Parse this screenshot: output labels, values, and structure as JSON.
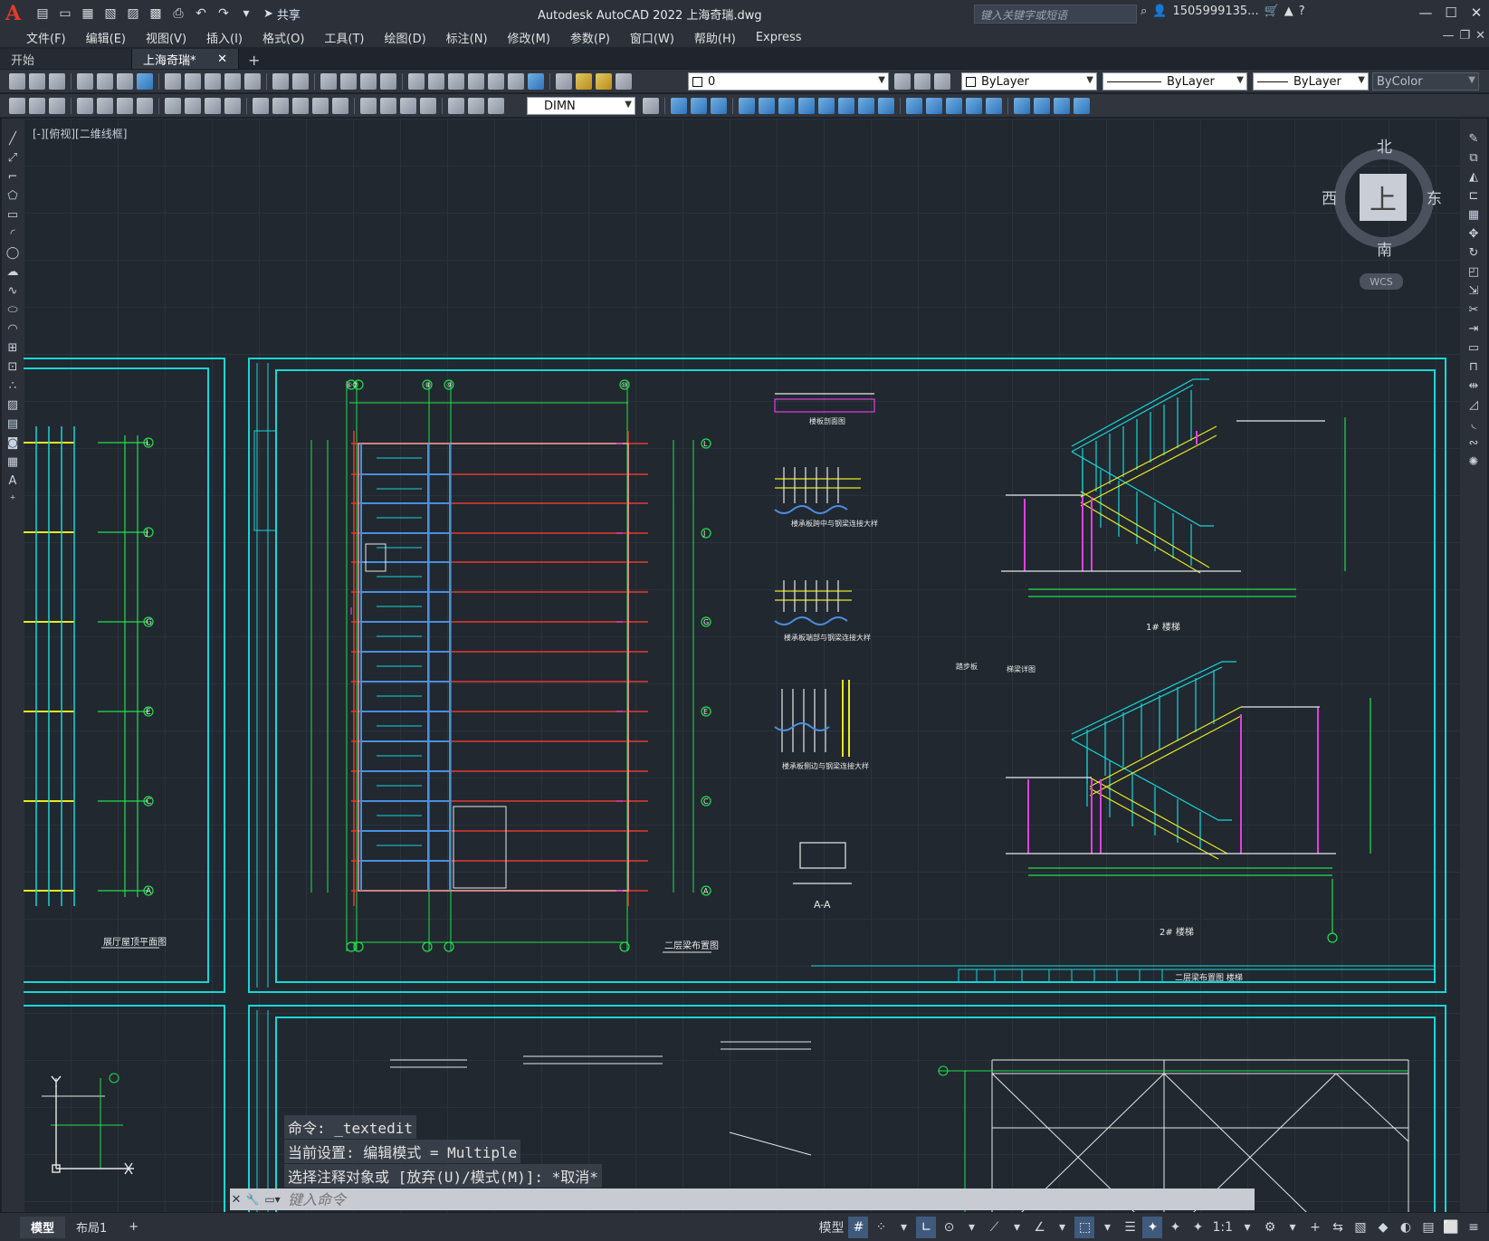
{
  "app": {
    "logo": "A",
    "title": "Autodesk AutoCAD 2022    上海奇瑞.dwg",
    "share_label": "共享",
    "search_placeholder": "键入关键字或短语",
    "user": "1505999135...",
    "accent": "#e23a2e"
  },
  "menu": [
    "文件(F)",
    "编辑(E)",
    "视图(V)",
    "插入(I)",
    "格式(O)",
    "工具(T)",
    "绘图(D)",
    "标注(N)",
    "修改(M)",
    "参数(P)",
    "窗口(W)",
    "帮助(H)",
    "Express"
  ],
  "tabs": {
    "start": "开始",
    "active": "上海奇瑞*",
    "close": "✕",
    "add": "+"
  },
  "toolbar": {
    "layer_value": "0",
    "color_value": "ByLayer",
    "linetype_value": "ByLayer",
    "lineweight_value": "ByLayer",
    "plotstyle_value": "ByColor",
    "dimstyle_value": "DIMN"
  },
  "viewport": {
    "label": "[-][俯视][二维线框]"
  },
  "viewcube": {
    "top": "上",
    "north": "北",
    "south": "南",
    "east": "东",
    "west": "西",
    "wcs": "WCS"
  },
  "drawing": {
    "grid_top_labels": [
      "⑥⑦",
      "⑧",
      "⑨",
      "⑩"
    ],
    "row_labels_right": [
      "L",
      "J",
      "G",
      "E",
      "C",
      "A"
    ],
    "row_labels_left": [
      "L",
      "J",
      "G",
      "E",
      "C",
      "A"
    ],
    "caption_plan": "二层梁布置图",
    "caption_left": "展厅屋顶平面图",
    "caption_stair1": "1# 楼梯",
    "caption_stair2": "2# 楼梯",
    "caption_section": "A-A",
    "caption_detail1": "楼板剖面图",
    "caption_detail2": "楼承板跨中与钢梁连接大样",
    "caption_detail3": "楼承板端部与钢梁连接大样",
    "caption_detail4": "楼承板侧边与钢梁连接大样",
    "title_block_text": "二层梁布置图  楼梯",
    "small_1": "踏步板",
    "small_2": "梯梁详图"
  },
  "command": {
    "history": [
      "命令: _textedit",
      "当前设置: 编辑模式 = Multiple",
      "选择注释对象或 [放弃(U)/模式(M)]: *取消*"
    ],
    "placeholder": "键入命令"
  },
  "status": {
    "model_tab": "模型",
    "layout_tab": "布局1",
    "add": "+",
    "model_btn": "模型",
    "scale": "1:1"
  }
}
